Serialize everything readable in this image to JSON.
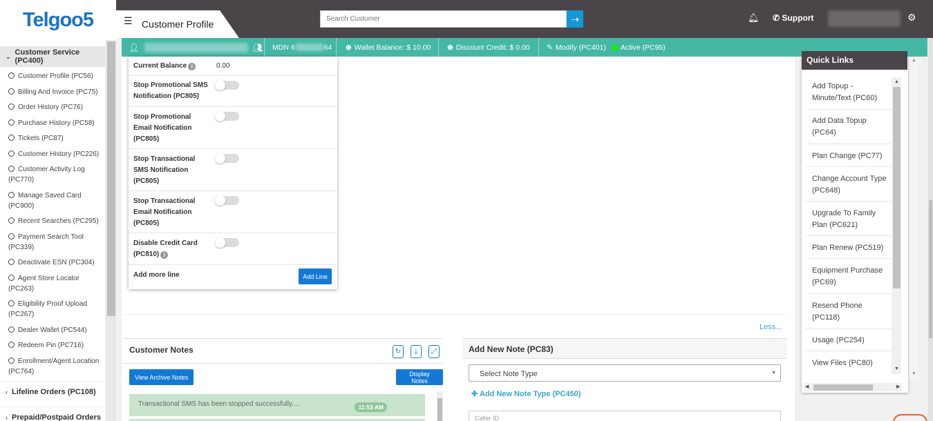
{
  "logo": {
    "text": "Telgoo",
    "digit": "5"
  },
  "sidebar": {
    "sections": [
      {
        "label": "Customer Service (PC400)"
      },
      {
        "label": "Lifeline Orders (PC108)"
      },
      {
        "label": "Prepaid/Postpaid Orders"
      }
    ],
    "items": [
      {
        "label": "Customer Profile (PC56)"
      },
      {
        "label": "Billing And Invoice (PC75)"
      },
      {
        "label": "Order History (PC76)"
      },
      {
        "label": "Purchase History (PC58)"
      },
      {
        "label": "Tickets (PC87)"
      },
      {
        "label": "Customer History (PC226)"
      },
      {
        "label": "Customer Activity Log (PC770)"
      },
      {
        "label": "Manage Saved Card (PC900)"
      },
      {
        "label": "Recent Searches (PC295)"
      },
      {
        "label": "Payment Search Tool (PC339)"
      },
      {
        "label": "Deactivate ESN (PC304)"
      },
      {
        "label": "Agent Store Locator (PC263)"
      },
      {
        "label": "Eligibility Proof Upload (PC267)"
      },
      {
        "label": "Dealer Wallet (PC544)"
      },
      {
        "label": "Redeem Pin (PC716)"
      },
      {
        "label": "Enrollment/Agent Location (PC764)"
      }
    ]
  },
  "header": {
    "title": "Customer Profile",
    "search_placeholder": "Search Customer",
    "support": "Support"
  },
  "infobar": {
    "mdn_prefix": "MDN 6",
    "mdn_suffix": "64",
    "wallet": "Wallet Balance: $ 10.00",
    "discount": "Discount Credit: $ 0.00",
    "modify": "Modify (PC401)",
    "active": "Active (PC95)"
  },
  "settings": {
    "current_balance_label": "Current Balance",
    "current_balance_value": "0.00",
    "rows": [
      {
        "label": "Stop Promotional SMS Notification (PC805)"
      },
      {
        "label": "Stop Promotional Email Notification (PC805)"
      },
      {
        "label": "Stop Transactional SMS Notification (PC805)"
      },
      {
        "label": "Stop Transactional Email Notification (PC805)"
      },
      {
        "label": "Disable Credit Card (PC810)"
      }
    ],
    "add_more_line": "Add more line",
    "add_line_btn": "Add Line"
  },
  "less_link": "Less...",
  "notes": {
    "title": "Customer Notes",
    "archive_btn": "View Archive Notes",
    "display_btn": "Display Notes",
    "message": "Transactional SMS has been stopped successfully....",
    "time": "11:53 AM"
  },
  "add_note": {
    "title": "Add New Note (PC83)",
    "select_placeholder": "Select Note Type",
    "add_type_link": "Add New Note Type (PC450)",
    "caller_id": "Caller ID"
  },
  "quick_links": {
    "title": "Quick Links",
    "items": [
      {
        "label": "Add Topup - Minute/Text (PC60)"
      },
      {
        "label": "Add Data Topup (PC64)"
      },
      {
        "label": "Plan Change (PC77)"
      },
      {
        "label": "Change Account Type (PC648)"
      },
      {
        "label": "Upgrade To Family Plan (PC621)"
      },
      {
        "label": "Plan Renew (PC519)"
      },
      {
        "label": "Equipment Purchase (PC69)"
      },
      {
        "label": "Resend Phone (PC118)"
      },
      {
        "label": "Usage (PC254)"
      },
      {
        "label": "View Files (PC80)"
      }
    ]
  },
  "colors": {
    "accent": "#45b8a5",
    "topbar": "#4a4549",
    "primary_button": "#1479d6",
    "link": "#3aa3c7"
  }
}
